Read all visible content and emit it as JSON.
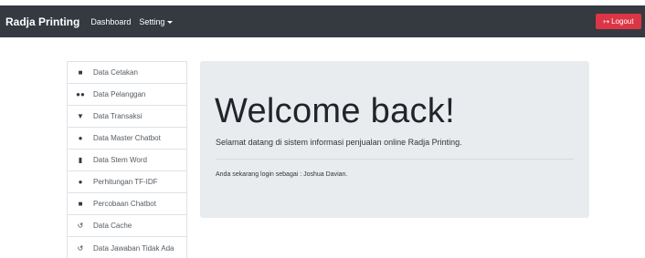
{
  "navbar": {
    "brand": "Radja Printing",
    "links": [
      "Dashboard",
      "Setting"
    ],
    "logout_label": "Logout",
    "bg_color": "#343a40",
    "logout_color": "#dc3545"
  },
  "sidebar": {
    "items": [
      {
        "label": "Data Cetakan",
        "icon": "file-icon"
      },
      {
        "label": "Data Pelanggan",
        "icon": "users-icon"
      },
      {
        "label": "Data Transaksi",
        "icon": "cart-icon"
      },
      {
        "label": "Data Master Chatbot",
        "icon": "comments-icon"
      },
      {
        "label": "Data Stem Word",
        "icon": "document-icon"
      },
      {
        "label": "Perhitungan TF-IDF",
        "icon": "comments-icon"
      },
      {
        "label": "Percobaan Chatbot",
        "icon": "comment-icon"
      },
      {
        "label": "Data Cache",
        "icon": "history-icon"
      },
      {
        "label": "Data Jawaban Tidak Ada",
        "icon": "history-icon"
      }
    ]
  },
  "main": {
    "heading": "Welcome back!",
    "lead": "Selamat datang di sistem informasi penjualan online Radja Printing.",
    "login_info": "Anda sekarang login sebagai : Joshua Davian."
  }
}
